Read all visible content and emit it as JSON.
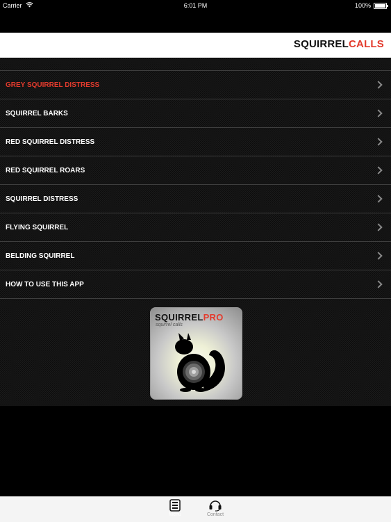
{
  "status_bar": {
    "carrier": "Carrier",
    "time": "6:01 PM",
    "battery": "100%"
  },
  "header": {
    "title_part1": "SQUIRREL",
    "title_part2": "CALLS",
    "accent_color": "#e33b2d"
  },
  "menu": {
    "items": [
      {
        "label": "GREY SQUIRREL DISTRESS",
        "active": true
      },
      {
        "label": "SQUIRREL BARKS"
      },
      {
        "label": "RED SQUIRREL DISTRESS"
      },
      {
        "label": "RED SQUIRREL ROARS"
      },
      {
        "label": "SQUIRREL DISTRESS"
      },
      {
        "label": "FLYING SQUIRREL"
      },
      {
        "label": "BELDING SQUIRREL"
      },
      {
        "label": "HOW TO USE THIS APP"
      }
    ]
  },
  "promo": {
    "brand_part1": "SQUIRREL",
    "brand_part2": "PRO",
    "tagline": "squirrel calls"
  },
  "tab_bar": {
    "tabs": [
      {
        "label": "Menu",
        "icon": "menu-icon"
      },
      {
        "label": "Contact",
        "icon": "headset-icon"
      }
    ]
  }
}
